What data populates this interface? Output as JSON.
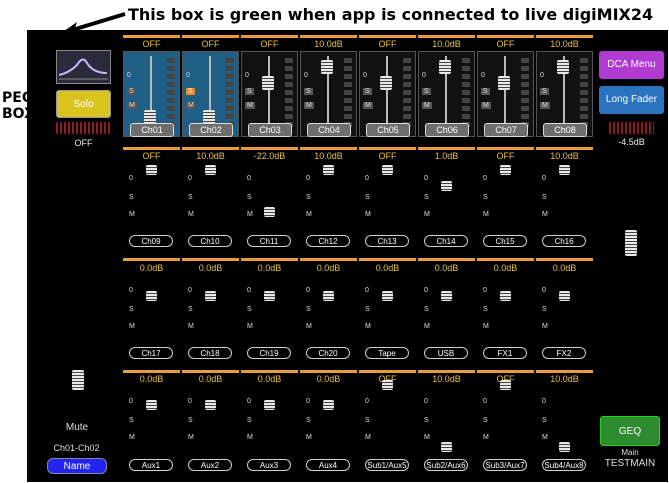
{
  "annotations": {
    "top": "This box is green when app is connected to live digiMIX24",
    "peq": "PEQ",
    "box": "BOX"
  },
  "left_panel": {
    "solo": "Solo",
    "off": "OFF",
    "mute": "Mute",
    "range": "Ch01-Ch02",
    "name": "Name"
  },
  "right_panel": {
    "dca": "DCA Menu",
    "long_fader": "Long Fader",
    "level": "-4.5dB",
    "geq": "GEQ",
    "main": "Main",
    "testmain": "TESTMAIN"
  },
  "bank1": {
    "values": [
      "OFF",
      "OFF",
      "OFF",
      "10.0dB",
      "OFF",
      "10.0dB",
      "OFF",
      "10.0dB"
    ],
    "names": [
      "Ch01",
      "Ch02",
      "Ch03",
      "Ch04",
      "Ch05",
      "Ch06",
      "Ch07",
      "Ch08"
    ]
  },
  "bank2": {
    "values": [
      "OFF",
      "10.0dB",
      "-22.0dB",
      "10.0dB",
      "OFF",
      "1.0dB",
      "OFF",
      "10.0dB"
    ],
    "names": [
      "Ch09",
      "Ch10",
      "Ch11",
      "Ch12",
      "Ch13",
      "Ch14",
      "Ch15",
      "Ch16"
    ]
  },
  "bank3": {
    "values": [
      "0.0dB",
      "0.0dB",
      "0.0dB",
      "0.0dB",
      "0.0dB",
      "0.0dB",
      "0.0dB",
      "0.0dB"
    ],
    "names": [
      "Ch17",
      "Ch18",
      "Ch19",
      "Ch20",
      "Tape",
      "USB",
      "FX1",
      "FX2"
    ]
  },
  "bank4": {
    "values": [
      "0.0dB",
      "0.0dB",
      "0.0dB",
      "0.0dB",
      "OFF",
      "10.0dB",
      "OFF",
      "10.0dB"
    ],
    "names": [
      "Aux1",
      "Aux2",
      "Aux3",
      "Aux4",
      "Sub1/Aux5",
      "Sub2/Aux6",
      "Sub3/Aux7",
      "Sub4/Aux8"
    ]
  },
  "labels": {
    "zero": "0",
    "s": "S",
    "m": "M"
  },
  "colors": {
    "connected": "#1bd31b",
    "value_text": "#e8c23a",
    "accent": "#e89d3a",
    "dca": "#b03bd1",
    "long_fader": "#2a73c0",
    "geq": "#2f8b2f",
    "solo": "#d8c41c",
    "name": "#2323f5"
  }
}
